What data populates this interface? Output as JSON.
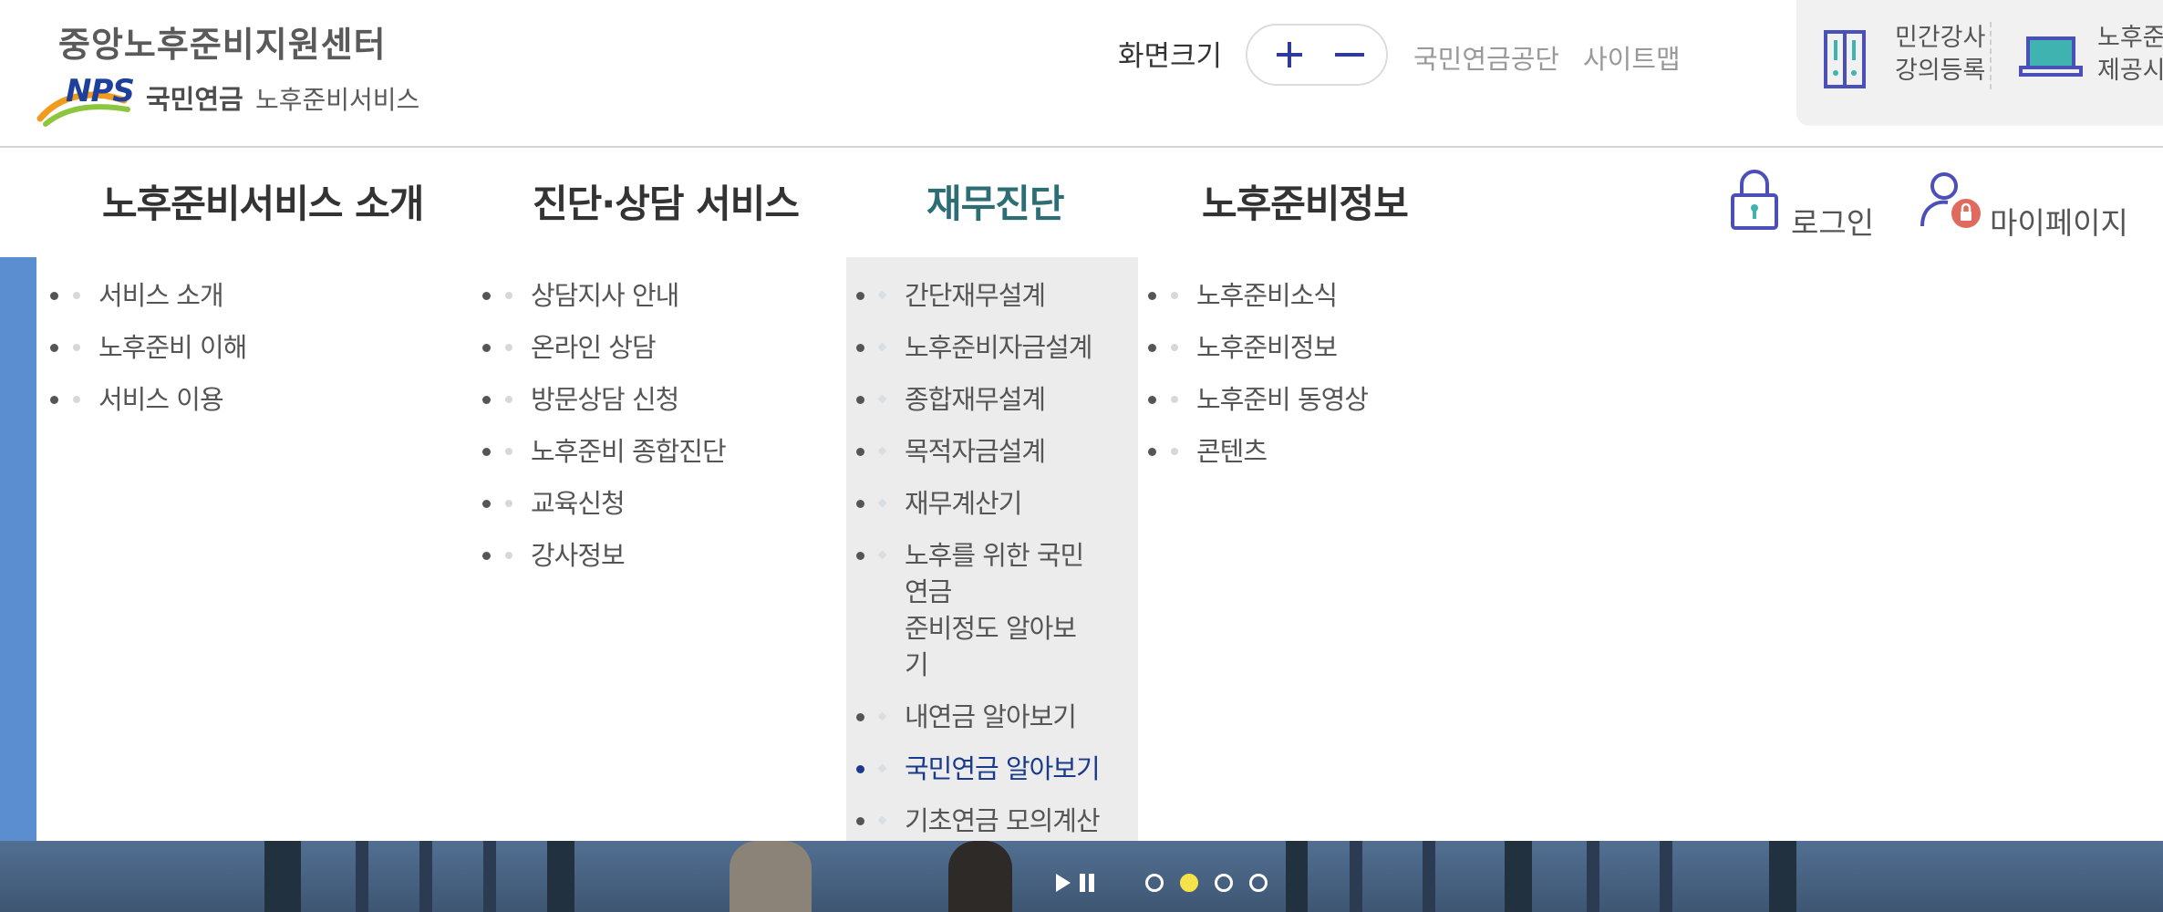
{
  "header": {
    "logo": {
      "center_name": "중앙노후준비지원센터",
      "nps": "NPS",
      "org": "국민연금",
      "service": "노후준비서비스"
    },
    "font_size": {
      "label": "화면크기",
      "plus": "+",
      "minus": "−"
    },
    "util_links": {
      "nps": "국민연금공단",
      "sitemap": "사이트맵"
    },
    "quick_links": [
      {
        "line1": "민간강사",
        "line2": "강의등록"
      },
      {
        "line1": "노후준",
        "line2": "제공시스"
      }
    ]
  },
  "gnb": {
    "items": [
      {
        "label": "노후준비서비스 소개"
      },
      {
        "label": "진단·상담 서비스"
      },
      {
        "label": "재무진단"
      },
      {
        "label": "노후준비정보"
      }
    ],
    "login": "로그인",
    "mypage": "마이페이지"
  },
  "submenu": {
    "col1": [
      "서비스 소개",
      "노후준비 이해",
      "서비스 이용"
    ],
    "col2": [
      "상담지사 안내",
      "온라인 상담",
      "방문상담 신청",
      "노후준비 종합진단",
      "교육신청",
      "강사정보"
    ],
    "col3": [
      "간단재무설계",
      "노후준비자금설계",
      "종합재무설계",
      "목적자금설계",
      "재무계산기",
      {
        "line1": "노후를 위한 국민연금",
        "line2": "준비정도 알아보기"
      },
      "내연금 알아보기",
      "국민연금 알아보기",
      "기초연금 모의계산"
    ],
    "col3_active_index": 7,
    "col4": [
      "노후준비소식",
      "노후준비정보",
      "노후준비 동영상",
      "콘텐츠"
    ]
  },
  "slider": {
    "dot_count": 4,
    "active_dot": 2
  },
  "colors": {
    "gnb_active": "#2d6e74",
    "submenu_active": "#1a3b8c",
    "highlight_column_bg": "#ececec",
    "slider_active_dot": "#f5e24a",
    "icon_purple": "#4b4fb8",
    "icon_teal": "#3fb3b0",
    "mypage_badge": "#e06a5e"
  },
  "icons": {
    "font_plus": "plus-icon",
    "font_minus": "minus-icon",
    "quick_1": "book-icon",
    "quick_2": "laptop-icon",
    "login": "lock-icon",
    "mypage": "user-lock-icon",
    "slider_play": "play-icon",
    "slider_pause": "pause-icon"
  }
}
